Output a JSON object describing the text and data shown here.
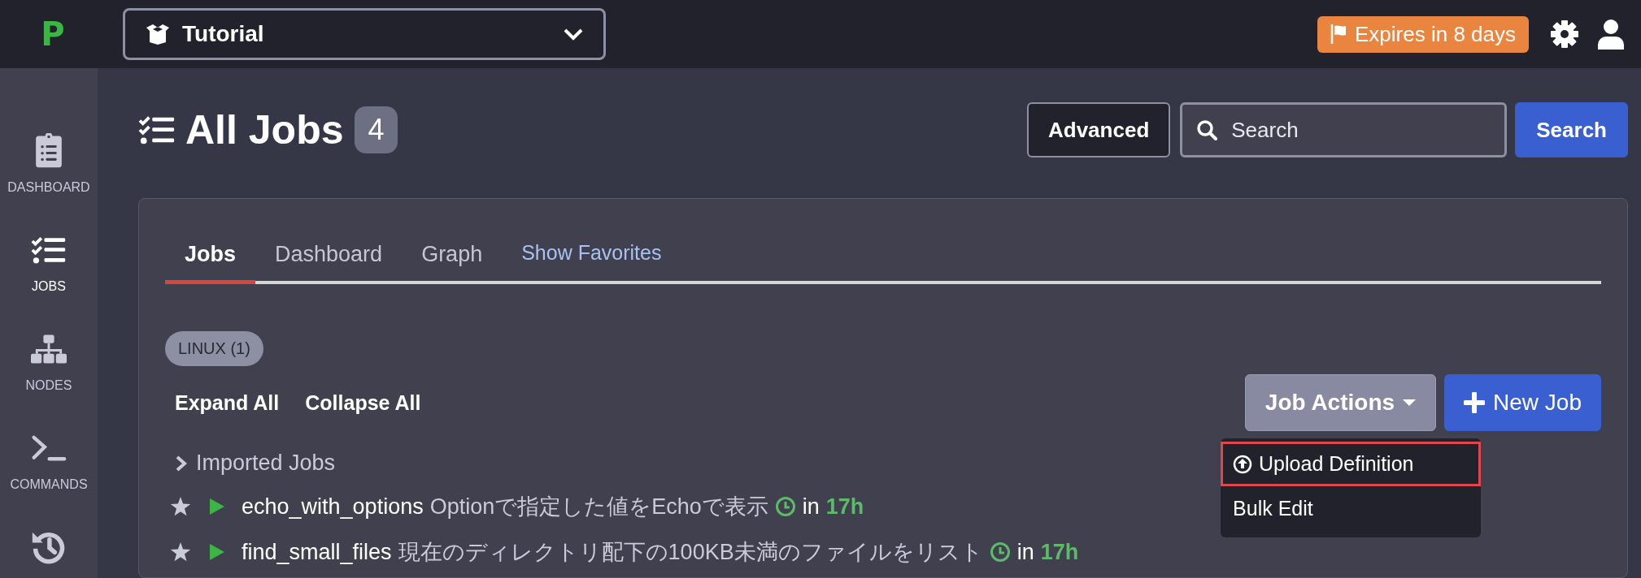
{
  "top_bar": {
    "logo": "P",
    "project": "Tutorial",
    "expiry_badge": "Expires in 8 days"
  },
  "sidebar": {
    "items": [
      {
        "kind": "dashboard",
        "label": "DASHBOARD",
        "selected": false
      },
      {
        "kind": "jobs",
        "label": "JOBS",
        "selected": true
      },
      {
        "kind": "nodes",
        "label": "NODES",
        "selected": false
      },
      {
        "kind": "commands",
        "label": "COMMANDS",
        "selected": false
      },
      {
        "kind": "activity",
        "selected": false
      }
    ]
  },
  "page": {
    "title": "All Jobs",
    "count": "4",
    "advanced_button": "Advanced",
    "search": {
      "placeholder": "Search"
    },
    "search_button": "Search"
  },
  "tabs": [
    {
      "kind": "tab",
      "label": "Jobs",
      "selected": true
    },
    {
      "kind": "tab",
      "label": "Dashboard",
      "selected": false
    },
    {
      "kind": "tab",
      "label": "Graph",
      "selected": false
    },
    {
      "kind": "link",
      "label": "Show Favorites",
      "selected": false
    }
  ],
  "filter_tag": "LINUX (1)",
  "expand_all": "Expand All",
  "collapse_all": "Collapse All",
  "job_actions_button": "Job Actions",
  "new_job_button": "New Job",
  "job_actions_menu": [
    {
      "kind": "upload",
      "label": "Upload Definition",
      "selected": true
    },
    {
      "kind": "plain",
      "label": "Bulk Edit",
      "selected": false
    }
  ],
  "group": {
    "label": "Imported Jobs",
    "expanded": false
  },
  "jobs": [
    {
      "name": "echo_with_options",
      "description": "Optionで指定した値をEchoで表示",
      "schedule_prefix": "in",
      "schedule": "17h"
    },
    {
      "name": "find_small_files",
      "description": "現在のディレクトリ配下の100KB未満のファイルをリスト",
      "schedule_prefix": "in",
      "schedule": "17h"
    }
  ]
}
